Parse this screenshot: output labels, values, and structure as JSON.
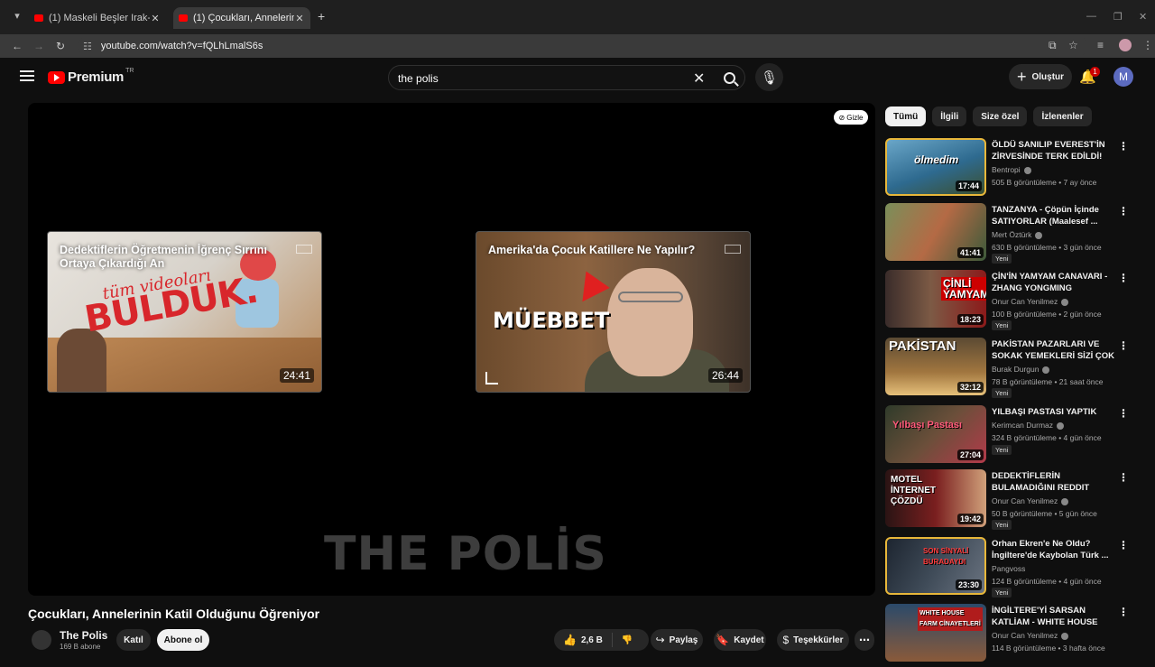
{
  "browser": {
    "tabs": [
      {
        "title": "(1) Maskeli Beşler Irak-Gece Nö"
      },
      {
        "title": "(1) Çocukları, Annelerinin Katil"
      }
    ],
    "url": "youtube.com/watch?v=fQLhLmalS6s"
  },
  "masthead": {
    "logo": "Premium",
    "country": "TR",
    "search_query": "the polis",
    "create_label": "Oluştur",
    "notifications_count": "1",
    "avatar_letter": "M"
  },
  "player": {
    "hide_label": "Gizle",
    "end_cards": [
      {
        "title": "Dedektiflerin Öğretmenin İğrenç Sırrını Ortaya Çıkardığı An",
        "duration": "24:41",
        "overlay_small": "tüm videoları",
        "overlay_big": "BULDUK."
      },
      {
        "title": "Amerika'da Çocuk Katillere Ne Yapılır?",
        "duration": "26:44",
        "overlay_big": "MÜEBBET"
      }
    ],
    "watermark": "THE POLİS"
  },
  "video": {
    "title": "Çocukları, Annelerinin Katil Olduğunu Öğreniyor",
    "channel": "The Polis",
    "subscribers": "169 B abone",
    "join_label": "Katıl",
    "subscribe_label": "Abone ol",
    "likes": "2,6 B",
    "share_label": "Paylaş",
    "save_label": "Kaydet",
    "thanks_label": "Teşekkürler"
  },
  "chips": [
    "Tümü",
    "İlgili",
    "Size özel",
    "İzlenenler"
  ],
  "recommendations": [
    {
      "title": "ÖLDÜ SANILIP EVEREST'İN ZİRVESİNDE TERK EDİLDİ!",
      "channel": "Bentropi",
      "meta": "505 B görüntüleme • 7 ay önce",
      "duration": "17:44",
      "thumb_text": "ölmedim",
      "new": ""
    },
    {
      "title": "TANZANYA - Çöpün İçinde SATIYORLAR (Maalesef ...",
      "channel": "Mert Öztürk",
      "meta": "630 B görüntüleme • 3 gün önce",
      "duration": "41:41",
      "thumb_text": "",
      "new": "Yeni"
    },
    {
      "title": "ÇİN'İN YAMYAM CANAVARI - ZHANG YONGMING",
      "channel": "Onur Can Yenilmez",
      "meta": "100 B görüntüleme • 2 gün önce",
      "duration": "18:23",
      "thumb_text": "ÇİNLİ YAMYAM",
      "new": "Yeni"
    },
    {
      "title": "PAKİSTAN PAZARLARI VE SOKAK YEMEKLERİ SİZİ ÇOK ...",
      "channel": "Burak Durgun",
      "meta": "78 B görüntüleme • 21 saat önce",
      "duration": "32:12",
      "thumb_text": "PAKİSTAN",
      "new": "Yeni"
    },
    {
      "title": "YILBAŞI PASTASI YAPTIK",
      "channel": "Kerimcan Durmaz",
      "meta": "324 B görüntüleme • 4 gün önce",
      "duration": "27:04",
      "thumb_text": "Yılbaşı Pastası",
      "new": "Yeni"
    },
    {
      "title": "DEDEKTİFLERİN BULAMADIĞINI REDDIT BULDU - LYLE STEVIK ...",
      "channel": "Onur Can Yenilmez",
      "meta": "50 B görüntüleme • 5 gün önce",
      "duration": "19:42",
      "thumb_text": "MOTEL İNTERNET ÇÖZDÜ",
      "new": "Yeni"
    },
    {
      "title": "Orhan Ekren'e Ne Oldu? İngiltere'de Kaybolan Türk ...",
      "channel": "Pangvoss",
      "meta": "124 B görüntüleme • 4 gün önce",
      "duration": "23:30",
      "thumb_text": "SON SİNYALİ BURADAYDI",
      "new": "Yeni"
    },
    {
      "title": "İNGİLTERE'Yİ SARSAN KATLİAM - WHITE HOUSE FARM ...",
      "channel": "Onur Can Yenilmez",
      "meta": "114 B görüntüleme • 3 hafta önce",
      "duration": "",
      "thumb_text": "WHITE HOUSE FARM CİNAYETLERİ",
      "new": ""
    }
  ],
  "colors": {
    "brand_red": "#ff0000",
    "bg": "#0f0f0f",
    "selected_outline": "#e8b73a"
  }
}
